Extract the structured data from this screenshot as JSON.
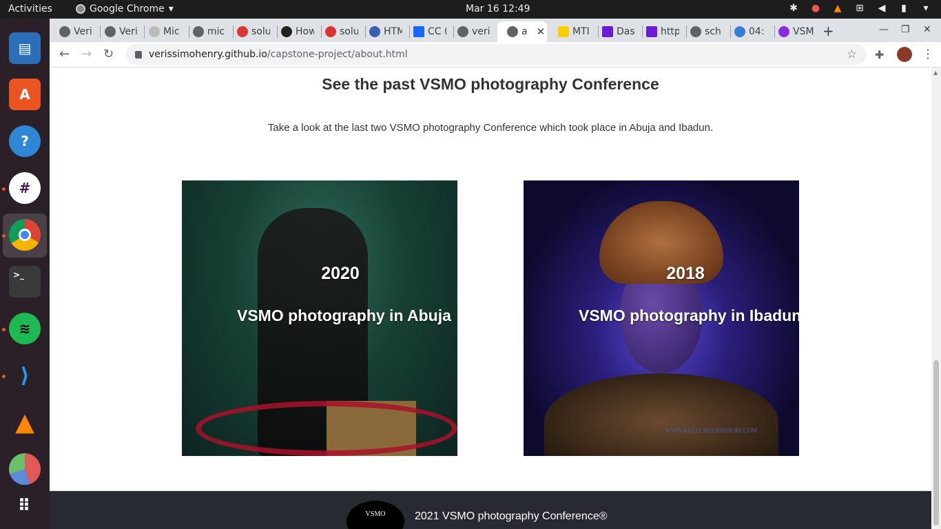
{
  "topbar": {
    "activities": "Activities",
    "app_name": "Google Chrome",
    "clock": "Mar 16  12:49",
    "tray_icons": [
      "slack-tray-icon",
      "notification-icon",
      "vlc-tray-icon",
      "network-icon",
      "volume-icon",
      "battery-icon",
      "power-icon"
    ]
  },
  "dock": {
    "apps": [
      "libreoffice-writer",
      "ubuntu-software",
      "help",
      "slack",
      "google-chrome",
      "terminal",
      "spotify",
      "vscode",
      "vlc",
      "disk-usage",
      "show-applications"
    ]
  },
  "tabs": [
    {
      "label": "Veri"
    },
    {
      "label": "Veri"
    },
    {
      "label": "Mic"
    },
    {
      "label": "mic"
    },
    {
      "label": "solu"
    },
    {
      "label": "How"
    },
    {
      "label": "solu"
    },
    {
      "label": "HTM"
    },
    {
      "label": "CC ("
    },
    {
      "label": "veri"
    },
    {
      "label": "a"
    },
    {
      "label": "MTI"
    },
    {
      "label": "Das"
    },
    {
      "label": "http"
    },
    {
      "label": "sch"
    },
    {
      "label": "04:"
    },
    {
      "label": "VSM"
    }
  ],
  "omnibox": {
    "host": "verissimohenry.github.io",
    "path": "/capstone-project/about.html"
  },
  "page": {
    "title": "See the past VSMO photography Conference",
    "description": "Take a look at the last two VSMO photography Conference which took place in Abuja and Ibadun.",
    "cards": [
      {
        "year": "2020",
        "label": "VSMO photography in Abuja"
      },
      {
        "year": "2018",
        "label": "VSMO photography in Ibadun",
        "watermark": "WWW.KELECHIAMADIOBI.COM"
      }
    ],
    "footer": {
      "logo_text": "VSMO",
      "copyright": "2021 VSMO photography Conference®"
    }
  },
  "colors": {
    "dock_bg": "#2b2027",
    "footer_bg": "#272a31",
    "accent_dot": "#e95420"
  }
}
